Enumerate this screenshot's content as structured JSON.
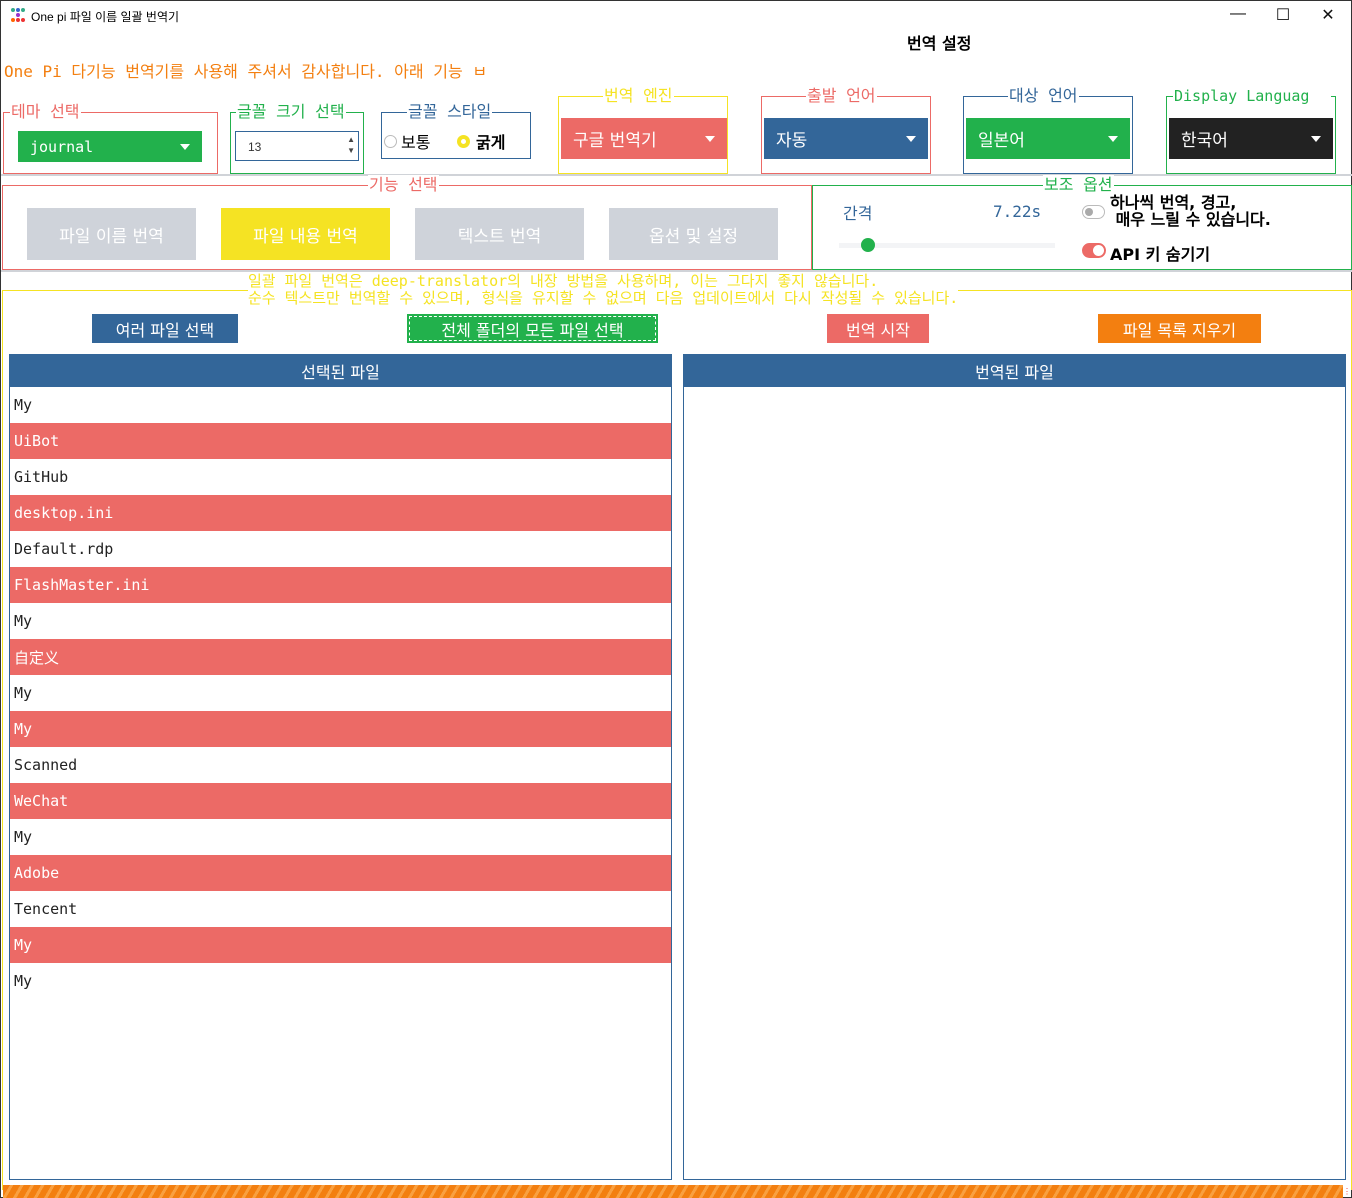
{
  "window": {
    "title": "One pi 파일 이름 일괄 번역기",
    "minimize": "—",
    "maximize": "☐",
    "close": "✕"
  },
  "header": {
    "title": "번역 설정",
    "welcome": "One Pi 다기능 번역기를 사용해 주셔서 감사합니다. 아래 기능 ㅂ"
  },
  "settings": {
    "theme": {
      "label": "테마 선택",
      "value": "journal"
    },
    "font_size": {
      "label": "글꼴 크기 선택",
      "value": "13"
    },
    "font_style": {
      "label": "글꼴 스타일",
      "options": [
        "보통",
        "굵게"
      ],
      "selected": "굵게"
    },
    "engine": {
      "label": "번역 엔진",
      "value": "구글 번역기"
    },
    "source": {
      "label": "출발 언어",
      "value": "자동"
    },
    "target": {
      "label": "대상 언어",
      "value": "일본어"
    },
    "display": {
      "label": "Display Languag",
      "value": "한국어"
    }
  },
  "functions": {
    "label": "기능 선택",
    "buttons": [
      "파일 이름 번역",
      "파일 내용 번역",
      "텍스트 번역",
      "옵션 및 설정"
    ],
    "active": 1
  },
  "aux": {
    "label": "보조 옵션",
    "interval_label": "간격",
    "interval_value": "7.22s",
    "interval_fraction": 0.1,
    "one_by_one": "하나씩 번역, 경고,\n 매우 느릴 수 있습니다.",
    "one_by_one_on": false,
    "hide_api": "API 키 숨기기",
    "hide_api_on": true
  },
  "notice": {
    "line1": "일괄 파일 번역은 deep-translator의 내장 방법을 사용하며, 이는 그다지 좋지 않습니다.",
    "line2": "순수 텍스트만 번역할 수 있으며, 형식을 유지할 수 없으며 다음 업데이트에서 다시 작성될 수 있습니다."
  },
  "actions": {
    "multi": "여러 파일 선택",
    "folder": "전체 폴더의 모든 파일 선택",
    "start": "번역 시작",
    "clear": "파일 목록 지우기"
  },
  "selected": {
    "title": "선택된 파일",
    "files": [
      "My",
      "UiBot",
      "GitHub",
      "desktop.ini",
      "Default.rdp",
      "FlashMaster.ini",
      "My",
      "自定义",
      "My",
      "My",
      "Scanned",
      "WeChat",
      "My",
      "Adobe",
      "Tencent",
      "My",
      "My"
    ]
  },
  "translated": {
    "title": "번역된 파일",
    "files": []
  },
  "progress": {
    "percent": 100
  },
  "colors": {
    "primary": "#336699",
    "success": "#22b14c",
    "danger": "#ec6a66",
    "warning": "#f5e323",
    "orange": "#f37f10",
    "dark": "#222222",
    "muted": "#cfd3da"
  }
}
